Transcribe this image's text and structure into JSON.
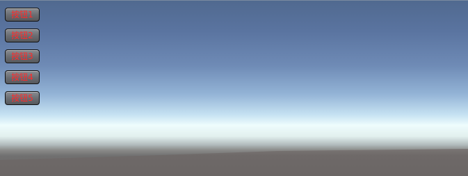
{
  "buttons": [
    {
      "label": "按钮1"
    },
    {
      "label": "按钮2"
    },
    {
      "label": "按钮3"
    },
    {
      "label": "按钮4"
    },
    {
      "label": "按钮5"
    }
  ],
  "colors": {
    "button_text": "#ff2a2a",
    "sky_top": "#50698f",
    "horizon": "#eefcfd",
    "ground": "#6c6766"
  }
}
